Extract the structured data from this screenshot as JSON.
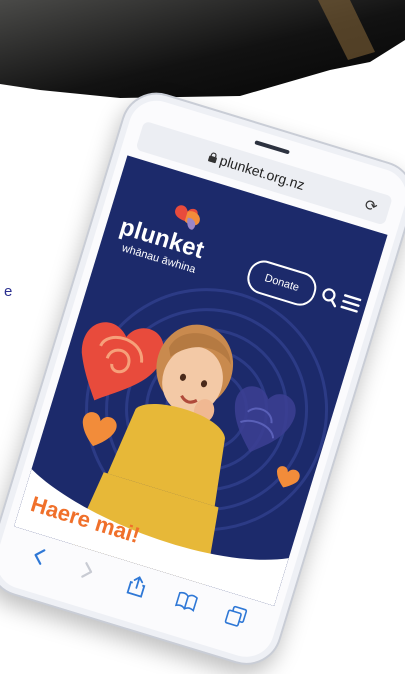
{
  "background_text": "e",
  "browser": {
    "url": "plunket.org.nz",
    "lock_icon": "lock-icon",
    "reload_icon": "reload-icon"
  },
  "site": {
    "logo_text": "plunket",
    "logo_subtitle": "whānau āwhina",
    "donate_label": "Donate",
    "search_icon": "search-icon",
    "menu_icon": "hamburger-menu-icon",
    "headline": "Haere mai!"
  },
  "toolbar": {
    "back_icon": "chevron-left-icon",
    "forward_icon": "chevron-right-icon",
    "share_icon": "share-icon",
    "bookmarks_icon": "book-icon",
    "tabs_icon": "tabs-icon"
  },
  "colors": {
    "brand_navy": "#1c2a6b",
    "brand_orange": "#f0702b",
    "accent_red": "#e84b3c",
    "accent_purple": "#5a4aa0"
  }
}
